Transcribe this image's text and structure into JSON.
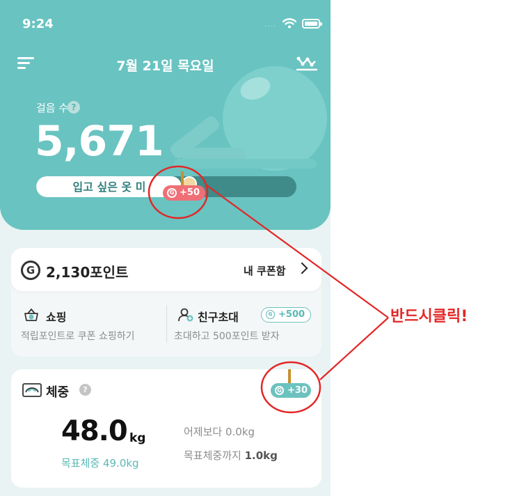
{
  "status_bar": {
    "time": "9:24",
    "dots": "....",
    "icons": [
      "wifi-icon",
      "battery-icon"
    ]
  },
  "header": {
    "date": "7월 21일 목요일",
    "menu_icon": "menu-icon",
    "stats_icon": "chart-icon"
  },
  "steps": {
    "label": "걸음 수",
    "help": "?",
    "value": "5,671",
    "goal_text": "입고 싶은 옷 미",
    "progress": 0.56,
    "reward": "+50",
    "reward_coin": "G"
  },
  "points_card": {
    "icon_letter": "G",
    "points": "2,130포인트",
    "coupon_link": "내 쿠폰함",
    "shopping": {
      "title": "쇼핑",
      "desc": "적립포인트로 쿠폰 쇼핑하기"
    },
    "invite": {
      "title": "친구초대",
      "badge": "+500",
      "desc": "초대하고 500포인트 받자"
    }
  },
  "weight_card": {
    "title": "체중",
    "help": "?",
    "reward": "+30",
    "value": "48.0",
    "unit": "kg",
    "goal": "목표체중 49.0kg",
    "vs_yesterday": "어제보다 0.0kg",
    "to_goal_label": "목표체중까지",
    "to_goal_value": "1.0kg"
  },
  "annotation": {
    "text": "반드시클릭!",
    "color": "#e32626"
  },
  "colors": {
    "teal": "#69c3c1",
    "teal_dark": "#3e8b89",
    "badge_red": "#ef6f76",
    "annotation_red": "#e32626"
  }
}
